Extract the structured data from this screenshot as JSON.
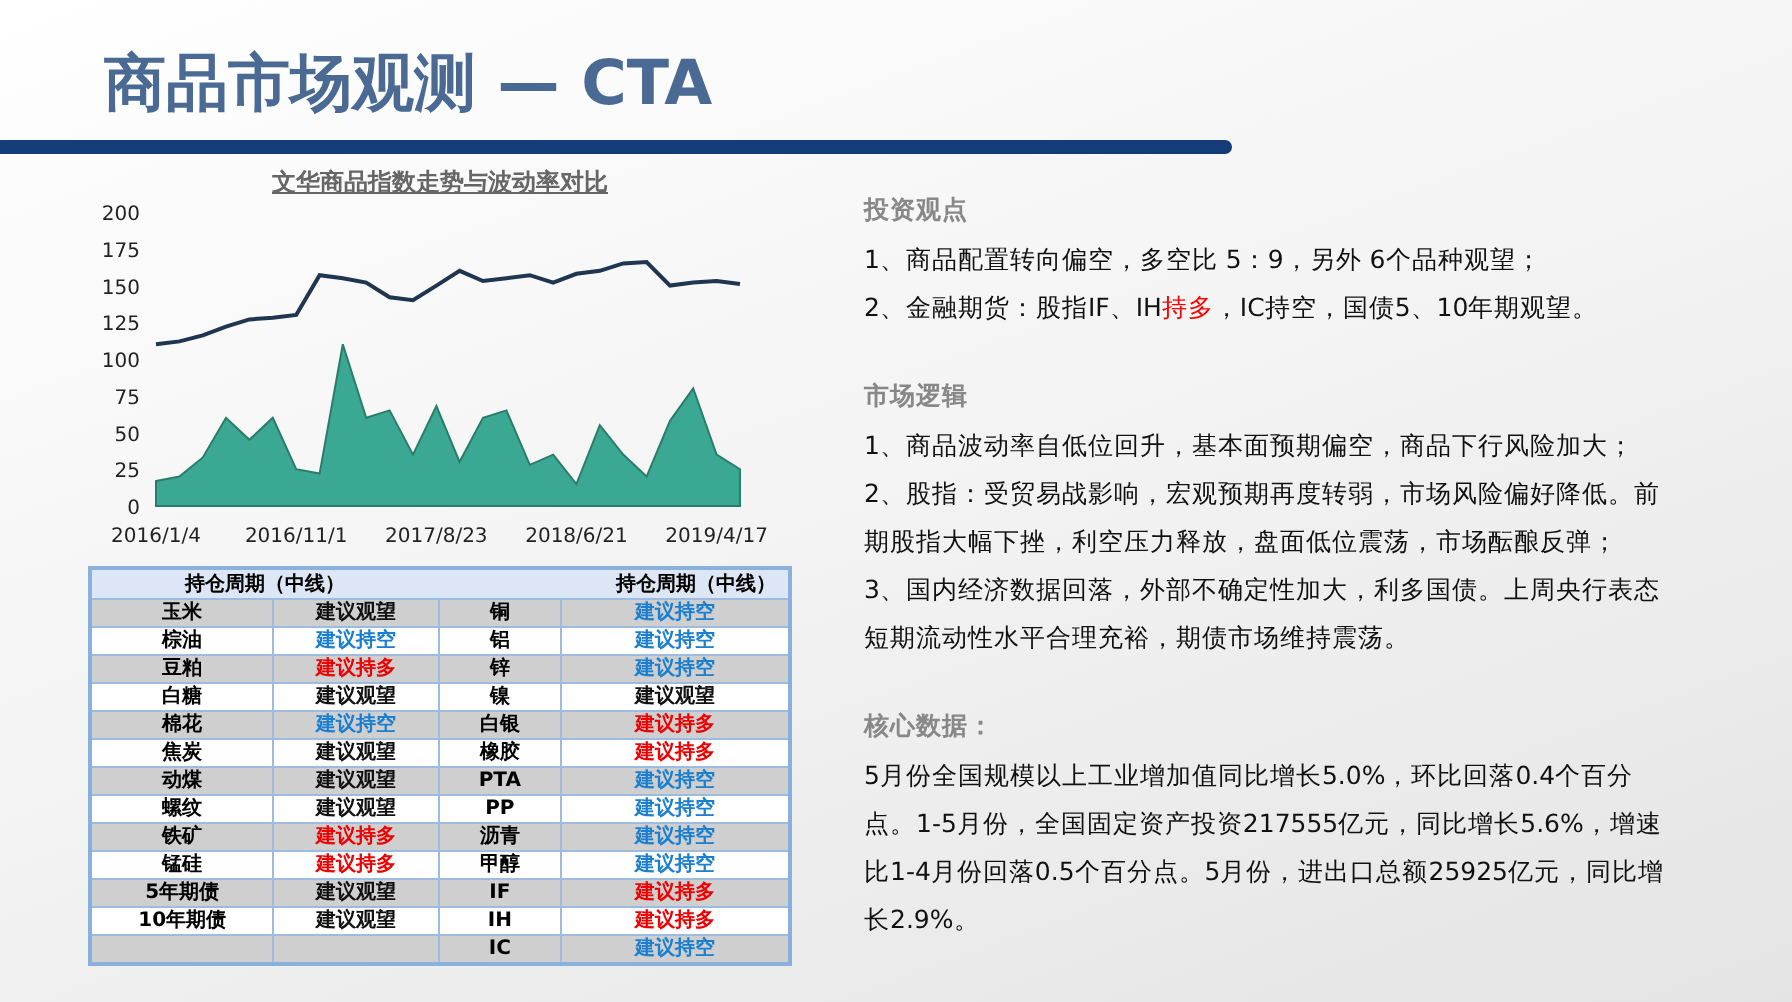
{
  "title": "商品市场观测 — CTA",
  "chart": {
    "title": "文华商品指数走势与波动率对比",
    "layers": [
      {
        "chart_data": {
          "type": "line",
          "categories": [
            "2016/1/4",
            null,
            null,
            null,
            null,
            null,
            "2016/11/1",
            null,
            null,
            null,
            null,
            null,
            "2017/8/23",
            null,
            null,
            null,
            null,
            null,
            "2018/6/21",
            null,
            null,
            null,
            null,
            null,
            "2019/4/17",
            null
          ],
          "ylim": [
            0,
            200
          ],
          "yticks": [
            0,
            25,
            50,
            75,
            100,
            125,
            150,
            175,
            200
          ],
          "series": [
            {
              "color": "#1f3550",
              "values": [
                110,
                112,
                116,
                122,
                127,
                128,
                130,
                157,
                155,
                152,
                142,
                140,
                150,
                160,
                153,
                155,
                157,
                152,
                158,
                160,
                165,
                166,
                150,
                152,
                153,
                151
              ]
            }
          ]
        }
      },
      {
        "chart_data": {
          "type": "area",
          "ylim": [
            0,
            200
          ],
          "series": [
            {
              "color": "#3aa892",
              "values": [
                17,
                20,
                33,
                60,
                45,
                60,
                25,
                22,
                110,
                60,
                65,
                35,
                68,
                30,
                60,
                65,
                28,
                35,
                15,
                55,
                35,
                20,
                58,
                80,
                35,
                25
              ]
            }
          ]
        }
      }
    ]
  },
  "table": {
    "headers": [
      "持仓周期（中线）",
      "持仓周期（中线）"
    ],
    "rows": [
      {
        "left": {
          "name": "玉米",
          "advice": "建议观望",
          "color": "#111111"
        },
        "right": {
          "name": "铜",
          "advice": "建议持空",
          "color": "#1a7fd0"
        }
      },
      {
        "left": {
          "name": "棕油",
          "advice": "建议持空",
          "color": "#1a7fd0"
        },
        "right": {
          "name": "铝",
          "advice": "建议持空",
          "color": "#1a7fd0"
        }
      },
      {
        "left": {
          "name": "豆粕",
          "advice": "建议持多",
          "color": "#f00000"
        },
        "right": {
          "name": "锌",
          "advice": "建议持空",
          "color": "#1a7fd0"
        }
      },
      {
        "left": {
          "name": "白糖",
          "advice": "建议观望",
          "color": "#111111"
        },
        "right": {
          "name": "镍",
          "advice": "建议观望",
          "color": "#111111"
        }
      },
      {
        "left": {
          "name": "棉花",
          "advice": "建议持空",
          "color": "#1a7fd0"
        },
        "right": {
          "name": "白银",
          "advice": "建议持多",
          "color": "#f00000"
        }
      },
      {
        "left": {
          "name": "焦炭",
          "advice": "建议观望",
          "color": "#111111"
        },
        "right": {
          "name": "橡胶",
          "advice": "建议持多",
          "color": "#f00000"
        }
      },
      {
        "left": {
          "name": "动煤",
          "advice": "建议观望",
          "color": "#111111"
        },
        "right": {
          "name": "PTA",
          "advice": "建议持空",
          "color": "#1a7fd0"
        }
      },
      {
        "left": {
          "name": "螺纹",
          "advice": "建议观望",
          "color": "#111111"
        },
        "right": {
          "name": "PP",
          "advice": "建议持空",
          "color": "#1a7fd0"
        }
      },
      {
        "left": {
          "name": "铁矿",
          "advice": "建议持多",
          "color": "#f00000"
        },
        "right": {
          "name": "沥青",
          "advice": "建议持空",
          "color": "#1a7fd0"
        }
      },
      {
        "left": {
          "name": "锰硅",
          "advice": "建议持多",
          "color": "#f00000"
        },
        "right": {
          "name": "甲醇",
          "advice": "建议持空",
          "color": "#1a7fd0"
        }
      },
      {
        "left": {
          "name": "5年期债",
          "advice": "建议观望",
          "color": "#111111"
        },
        "right": {
          "name": "IF",
          "advice": "建议持多",
          "color": "#f00000"
        }
      },
      {
        "left": {
          "name": "10年期债",
          "advice": "建议观望",
          "color": "#111111"
        },
        "right": {
          "name": "IH",
          "advice": "建议持多",
          "color": "#f00000"
        }
      },
      {
        "right": {
          "name": "IC",
          "advice": "建议持空",
          "color": "#1a7fd0"
        }
      }
    ]
  },
  "sections": [
    {
      "heading": "投资观点",
      "paragraphs": [
        [
          {
            "text": "1、商品配置转向偏空，多空比 5：9，另外 6个品种观望；"
          }
        ],
        [
          {
            "text": "2、金融期货：股指IF、IH"
          },
          {
            "text": "持多",
            "highlight": true
          },
          {
            "text": "，IC持空，国债5、10年期观望。"
          }
        ]
      ]
    },
    {
      "heading": "市场逻辑",
      "paragraphs": [
        [
          {
            "text": "1、商品波动率自低位回升，基本面预期偏空，商品下行风险加大；"
          }
        ],
        [
          {
            "text": "2、股指：受贸易战影响，宏观预期再度转弱，市场风险偏好降低。前期股指大幅下挫，利空压力释放，盘面低位震荡，市场酝酿反弹；"
          }
        ],
        [
          {
            "text": "3、国内经济数据回落，外部不确定性加大，利多国债。上周央行表态短期流动性水平合理充裕，期债市场维持震荡。"
          }
        ]
      ]
    },
    {
      "heading": "核心数据：",
      "paragraphs": [
        [
          {
            "text": "5月份全国规模以上工业增加值同比增长5.0%，环比回落0.4个百分点。1-5月份，全国固定资产投资217555亿元，同比增长5.6%，增速比1-4月份回落0.5个百分点。5月份，进出口总额25925亿元，同比增长2.9%。"
          }
        ]
      ]
    }
  ]
}
